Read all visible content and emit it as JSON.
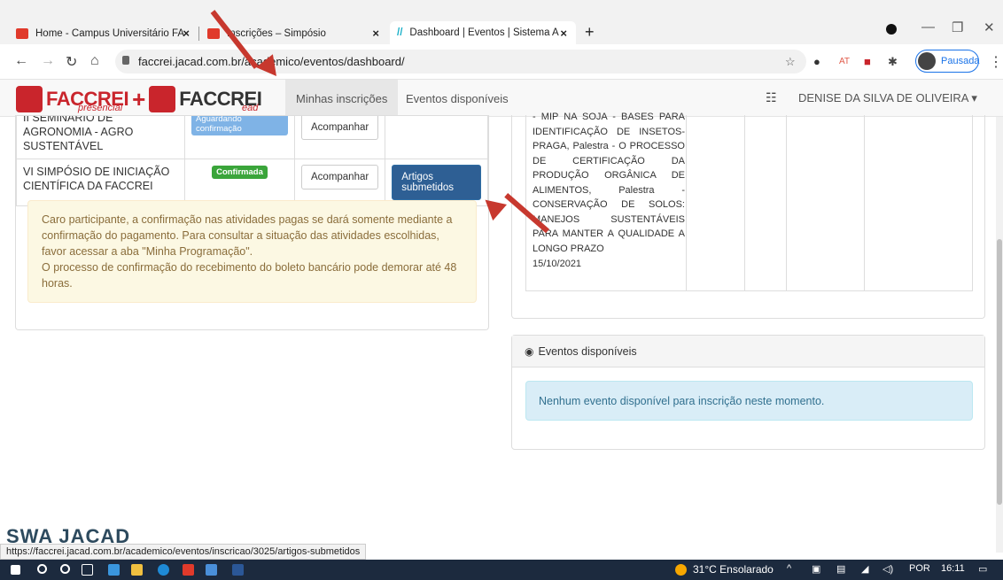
{
  "browser": {
    "tabs": [
      {
        "title": "Home - Campus Universitário FA",
        "close": "×"
      },
      {
        "title": "Inscrições – Simpósio",
        "close": "×"
      },
      {
        "title": "Dashboard | Eventos | Sistema A",
        "close": "×"
      }
    ],
    "new_tab": "+",
    "url": "faccrei.jacad.com.br/academico/eventos/dashboard/",
    "sync_label": "Pausada"
  },
  "app": {
    "logo_left": "FACCREI",
    "logo_left_sub": "presencial",
    "logo_right": "FACCREI",
    "logo_right_sub": "ead",
    "nav": [
      "Minhas inscrições",
      "Eventos disponíveis"
    ],
    "user": "DENISE DA SILVA DE OLIVEIRA ▾"
  },
  "inscriptions": [
    {
      "name": "II SEMINÁRIO DE AGRONOMIA - AGRO SUSTENTÁVEL",
      "status": "Aguardando confirmação",
      "action": "Acompanhar"
    },
    {
      "name": "VI SIMPÓSIO DE INICIAÇÃO CIENTÍFICA DA FACCREI",
      "status": "Confirmada",
      "action": "Acompanhar",
      "extra": "Artigos submetidos"
    }
  ],
  "warning": "Caro participante, a confirmação nas atividades pagas se dará somente mediante a confirmação do pagamento. Para consultar a situação das atividades escolhidas, favor acessar a aba \"Minha Programação\".\nO processo de confirmação do recebimento do boleto bancário pode demorar até 48 horas.",
  "programming": {
    "text": "- MIP NA SOJA - BASES PARA IDENTIFICAÇÃO DE INSETOS-PRAGA, Palestra - O PROCESSO DE CERTIFICAÇÃO DA PRODUÇÃO ORGÂNICA DE ALIMENTOS, Palestra - CONSERVAÇÃO DE SOLOS: MANEJOS SUSTENTÁVEIS PARA MANTER A QUALIDADE A LONGO PRAZO",
    "date": "15/10/2021"
  },
  "available": {
    "header": "Eventos disponíveis",
    "message": "Nenhum evento disponível para inscrição neste momento."
  },
  "footer": {
    "logo": "SWA JACAD",
    "status_url": "https://faccrei.jacad.com.br/academico/eventos/inscricao/3025/artigos-submetidos"
  },
  "taskbar": {
    "weather": "31°C  Ensolarado",
    "lang": "POR",
    "time": "16:11"
  },
  "colors": {
    "brand": "#c9252c",
    "primary": "#2e5f94",
    "annotation_arrow": "#c7382e"
  }
}
